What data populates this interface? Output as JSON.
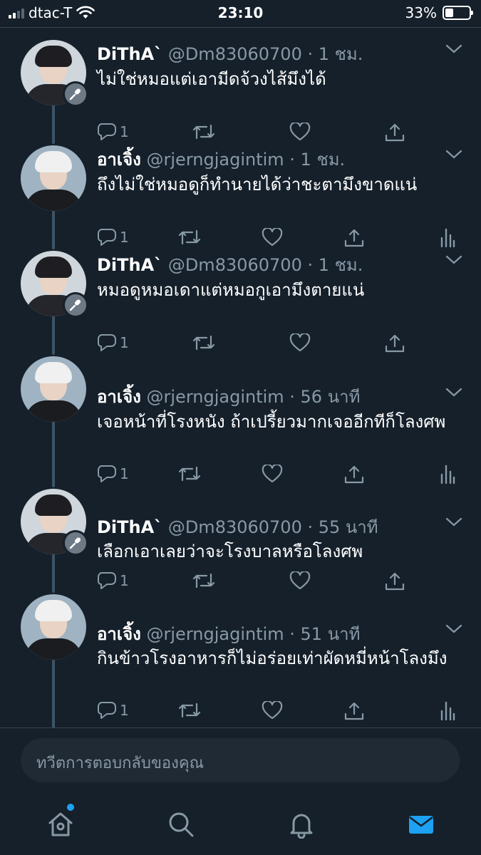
{
  "status_bar": {
    "carrier": "dtac-T",
    "time": "23:10",
    "battery_percent": "33%",
    "battery_level": 0.33,
    "signal_bars": 2
  },
  "colors": {
    "background": "#15202b",
    "accent": "#1da1f2",
    "muted_text": "#8899a6",
    "divider": "#38444d"
  },
  "tweets": [
    {
      "name": "DiThA`",
      "handle_time": "@Dm83060700 · 1 ชม.",
      "text": "ไม่ใช่หมอแต่เอามีดจ้วงไส้มึงได้",
      "reply_count": "1",
      "has_mic_badge": true,
      "has_analytics": false
    },
    {
      "name": "อาเจิ้ง",
      "handle_time": "@rjerngjagintim · 1 ชม.",
      "text": "ถึงไม่ใช่หมอดูก็ทำนายได้ว่าชะตามึงขาดแน่",
      "reply_count": "1",
      "has_mic_badge": false,
      "has_analytics": true
    },
    {
      "name": "DiThA`",
      "handle_time": "@Dm83060700 · 1 ชม.",
      "text": "หมอดูหมอเดาแต่หมอกูเอามึงตายแน่",
      "reply_count": "1",
      "has_mic_badge": true,
      "has_analytics": false
    },
    {
      "name": "อาเจิ้ง",
      "handle_time": "@rjerngjagintim · 56 นาที",
      "text": "เจอหน้าที่โรงหนัง ถ้าเปรี้ยวมากเจออีกทีก็โลงศพ",
      "reply_count": "1",
      "has_mic_badge": false,
      "has_analytics": true
    },
    {
      "name": "DiThA`",
      "handle_time": "@Dm83060700 · 55 นาที",
      "text": "เลือกเอาเลยว่าจะโรงบาลหรือโลงศพ",
      "reply_count": "1",
      "has_mic_badge": true,
      "has_analytics": false
    },
    {
      "name": "อาเจิ้ง",
      "handle_time": "@rjerngjagintim · 51 นาที",
      "text": "กินข้าวโรงอาหารก็ไม่อร่อยเท่าผัดหมี่หน้าโลงมึง",
      "reply_count": "1",
      "has_mic_badge": false,
      "has_analytics": true
    }
  ],
  "reply": {
    "placeholder": "ทวีตการตอบกลับของคุณ"
  },
  "tab_bar": {
    "items": [
      "home-icon",
      "search-icon",
      "bell-icon",
      "mail-icon"
    ],
    "active": "mail-icon"
  }
}
